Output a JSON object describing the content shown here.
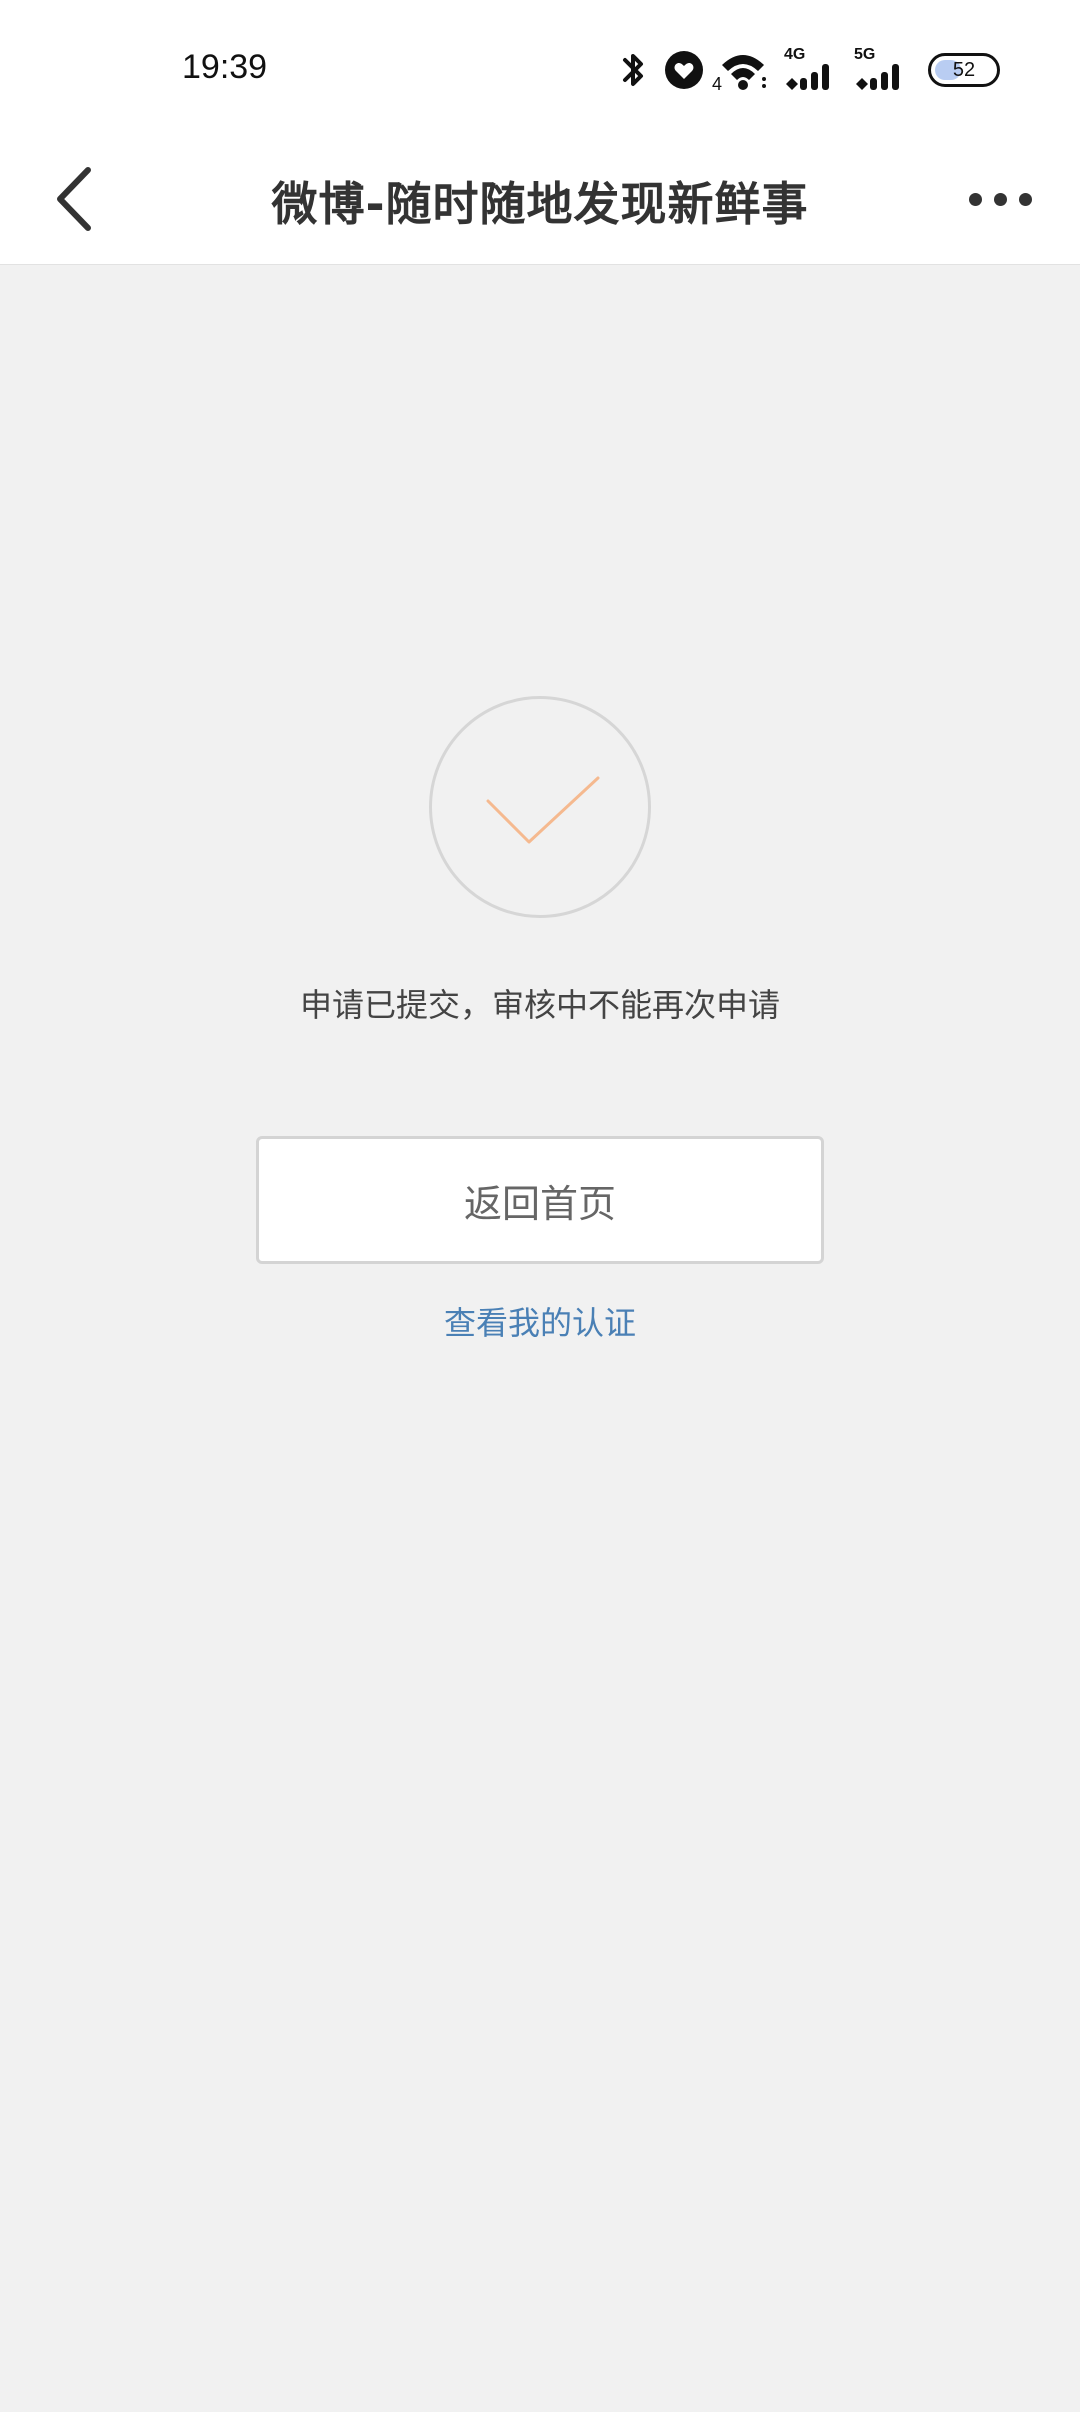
{
  "status_bar": {
    "time": "19:39",
    "battery": "52",
    "network_1": "4G",
    "network_2": "5G",
    "wifi_sub": "4"
  },
  "nav": {
    "title": "微博-随时随地发现新鲜事"
  },
  "main": {
    "message": "申请已提交，审核中不能再次申请",
    "home_button_label": "返回首页",
    "view_link_label": "查看我的认证"
  },
  "colors": {
    "accent_check": "#f5b98f",
    "link": "#4a80b5",
    "background": "#f1f1f1"
  }
}
